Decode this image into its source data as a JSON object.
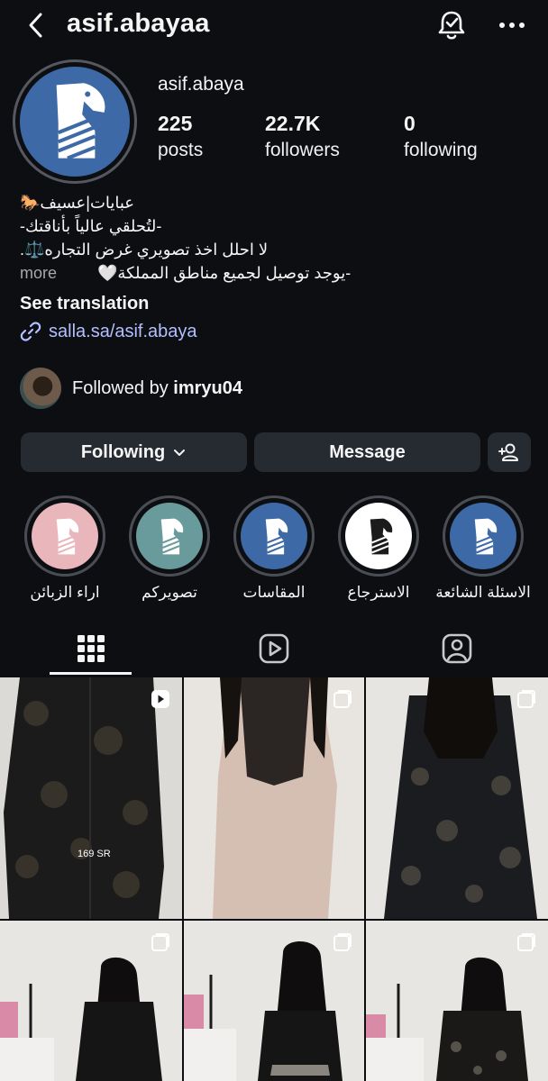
{
  "header": {
    "username": "asif.abayaa",
    "icons": {
      "back": "chevron-left-icon",
      "notify": "bell-check-icon",
      "more": "more-horizontal-icon"
    }
  },
  "profile": {
    "name": "asif.abaya",
    "stats": [
      {
        "num": "225",
        "label": "posts"
      },
      {
        "num": "22.7K",
        "label": "followers"
      },
      {
        "num": "0",
        "label": "following"
      }
    ],
    "bio_lines": [
      "عبايات|عسيف🐎",
      "-لتُحلقي عالياً بأناقتك-",
      "لا احلل اخذ تصويري غرض التجاره⚖️.",
      "-يوجد توصيل لجميع مناطق المملكة🤍"
    ],
    "more_label": "more",
    "see_translation": "See translation",
    "link": "salla.sa/asif.abaya"
  },
  "followed_by": {
    "prefix": "Followed by",
    "user": "imryu04"
  },
  "buttons": {
    "following": "Following",
    "message": "Message"
  },
  "highlights": [
    {
      "label": "اراء الزبائن",
      "bg": "#e9b7bb"
    },
    {
      "label": "تصويركم",
      "bg": "#6a9b9c"
    },
    {
      "label": "المقاسات",
      "bg": "#3d6aa6"
    },
    {
      "label": "الاسترجاع",
      "bg": "#ffffff"
    },
    {
      "label": "الاسئلة الشائعة",
      "bg": "#3d6aa6"
    }
  ],
  "grid": {
    "posts": [
      {
        "type": "reel",
        "caption": "169 SR"
      },
      {
        "type": "carousel"
      },
      {
        "type": "carousel"
      },
      {
        "type": "carousel"
      },
      {
        "type": "carousel"
      },
      {
        "type": "carousel"
      }
    ]
  },
  "colors": {
    "background": "#0c0e12",
    "button": "#262a31",
    "link": "#b4bfff",
    "brand_blue": "#3d6aa6"
  }
}
